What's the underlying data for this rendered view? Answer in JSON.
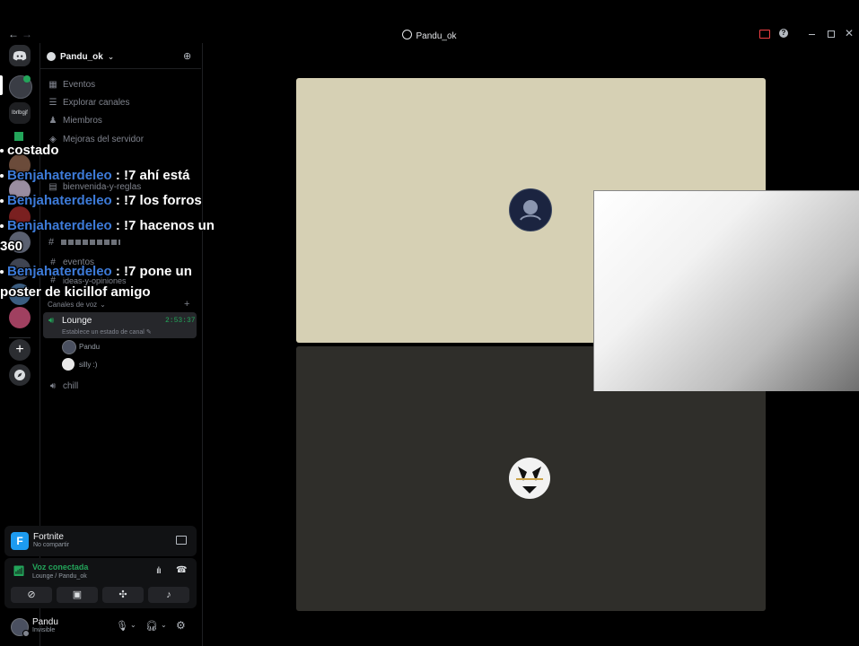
{
  "window": {
    "title": "Pandu_ok",
    "back_icon": "←",
    "forward_icon": "→"
  },
  "server": {
    "name": "Pandu_ok",
    "rail_label": "lbrlbgjf"
  },
  "menu": [
    {
      "icon": "calendar-icon",
      "label": "Eventos"
    },
    {
      "icon": "explore-icon",
      "label": "Explorar canales"
    },
    {
      "icon": "members-icon",
      "label": "Miembros"
    },
    {
      "icon": "boost-icon",
      "label": "Mejoras del servidor"
    }
  ],
  "text_channels": [
    {
      "label": "bienvenida-y-reglas"
    },
    {
      "label": "eventos"
    },
    {
      "label": "ideas-y-opiniones"
    }
  ],
  "voice_section": {
    "title": "Canales de voz",
    "active_channel": "Lounge",
    "timer": "2:53:37",
    "status_hint": "Establece un estado de canal",
    "participants": [
      "Pandu",
      "silly :)"
    ],
    "other_channel": "chill"
  },
  "chat_overlay": [
    {
      "user": "",
      "text": "costado"
    },
    {
      "user": "Benjahaterdeleo",
      "text": " : !7 ahí está"
    },
    {
      "user": "Benjahaterdeleo",
      "text": " : !7 los forros"
    },
    {
      "user": "Benjahaterdeleo",
      "text": " : !7 hacenos un"
    },
    {
      "user": "",
      "text": "360"
    },
    {
      "user": "Benjahaterdeleo",
      "text": " : !7 pone un"
    },
    {
      "user": "",
      "text": "poster de kicillof amigo"
    }
  ],
  "activity": {
    "game": "Fortnite",
    "state": "No compartir"
  },
  "voice_status": {
    "title": "Voz conectada",
    "detail": "Lounge / Pandu_ok"
  },
  "user": {
    "name": "Pandu",
    "status": "Invisible"
  },
  "colors": {
    "background": "#000000",
    "tile_top": "#d6d0b4",
    "tile_bottom": "#2f2e2a",
    "voice_green": "#23a55a",
    "username_blue": "#3d7bd9",
    "fortnite_blue": "#1d9bf0"
  }
}
